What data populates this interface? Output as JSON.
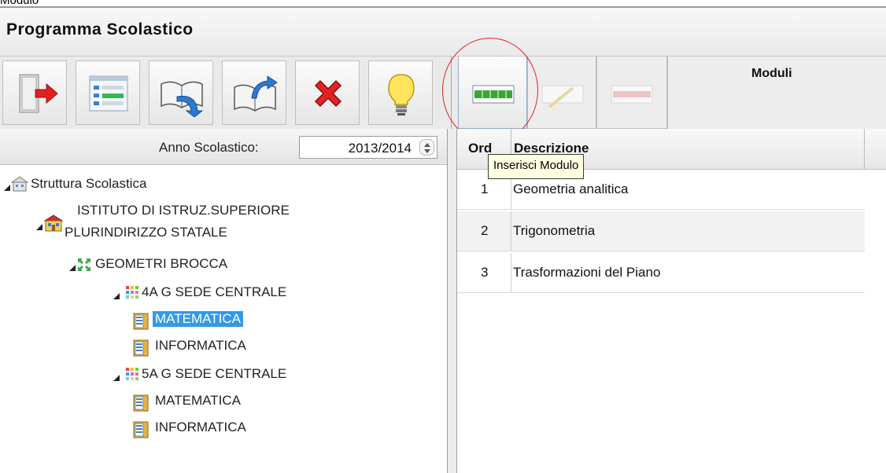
{
  "window": {
    "cut_label": "Modulo",
    "title": "Programma Scolastico"
  },
  "toolbar": {
    "buttons": [
      {
        "name": "exit",
        "icon": "exit-door-icon"
      },
      {
        "name": "form",
        "icon": "form-icon"
      },
      {
        "name": "book-import",
        "icon": "book-arrow-in-icon"
      },
      {
        "name": "book-export",
        "icon": "book-arrow-out-icon"
      },
      {
        "name": "delete",
        "icon": "red-x-icon"
      },
      {
        "name": "hint",
        "icon": "lightbulb-icon"
      }
    ]
  },
  "right_toolbar": {
    "section_label": "Moduli",
    "buttons": [
      {
        "name": "insert-module",
        "icon": "green-grid-icon",
        "state": "active"
      },
      {
        "name": "edit-module",
        "icon": "pencil-grid-icon",
        "state": "disabled"
      },
      {
        "name": "delete-module",
        "icon": "red-grid-icon",
        "state": "disabled"
      }
    ]
  },
  "year": {
    "label": "Anno Scolastico:",
    "value": "2013/2014"
  },
  "tree": {
    "root": "Struttura Scolastica",
    "school_line1": "ISTITUTO DI ISTRUZ.SUPERIORE",
    "school_line2": "PLURINDIRIZZO STATALE",
    "branch": "GEOMETRI BROCCA",
    "class_1": "4A G SEDE CENTRALE",
    "class_1_subjects": [
      "MATEMATICA",
      "INFORMATICA"
    ],
    "class_2": "5A G SEDE CENTRALE",
    "class_2_subjects": [
      "MATEMATICA",
      "INFORMATICA"
    ],
    "selected": "class_1_subject_0"
  },
  "grid": {
    "columns": {
      "order": "Ord",
      "description": "Descrizione"
    },
    "rows": [
      {
        "order": "1",
        "description": "Geometria analitica"
      },
      {
        "order": "2",
        "description": "Trigonometria"
      },
      {
        "order": "3",
        "description": "Trasformazioni del Piano"
      }
    ]
  },
  "tooltip": {
    "text": "Inserisci Modulo"
  },
  "colors": {
    "selection": "#3399e8",
    "highlight_circle": "#e0242a",
    "tooltip_bg": "#ffffe1"
  }
}
